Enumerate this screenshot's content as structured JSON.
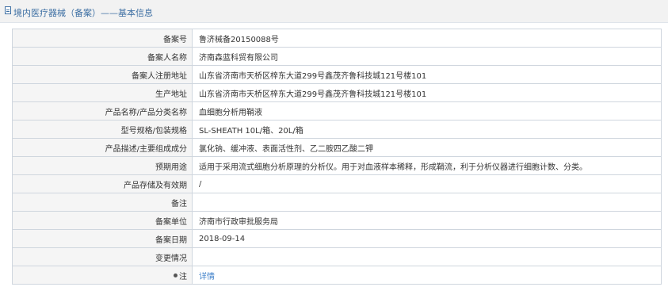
{
  "header": {
    "title": "境内医疗器械（备案）——基本信息",
    "icon": "document-icon"
  },
  "rows": [
    {
      "label": "备案号",
      "value": "鲁济械备20150088号"
    },
    {
      "label": "备案人名称",
      "value": "济南森蓝科贸有限公司"
    },
    {
      "label": "备案人注册地址",
      "value": "山东省济南市天桥区梓东大道299号鑫茂齐鲁科技城121号楼101"
    },
    {
      "label": "生产地址",
      "value": "山东省济南市天桥区梓东大道299号鑫茂齐鲁科技城121号楼101"
    },
    {
      "label": "产品名称/产品分类名称",
      "value": "血细胞分析用鞘液"
    },
    {
      "label": "型号规格/包装规格",
      "value": "SL-SHEATH 10L/箱、20L/箱"
    },
    {
      "label": "产品描述/主要组成成分",
      "value": "氯化钠、缓冲液、表面活性剂、乙二胺四乙酸二钾"
    },
    {
      "label": "预期用途",
      "value": "适用于采用流式细胞分析原理的分析仪。用于对血液样本稀释，形成鞘流，利于分析仪器进行细胞计数、分类。"
    },
    {
      "label": "产品存储及有效期",
      "value": "/"
    },
    {
      "label": "备注",
      "value": ""
    },
    {
      "label": "备案单位",
      "value": "济南市行政审批服务局"
    },
    {
      "label": "备案日期",
      "value": "2018-09-14"
    },
    {
      "label": "变更情况",
      "value": ""
    }
  ],
  "note": {
    "label": "注",
    "icon": "pin-icon",
    "link": "详情"
  },
  "colors": {
    "link": "#3d7fc9",
    "title": "#3d6fa3",
    "label_bg": "#f5f5f5",
    "border": "#cfd6de"
  }
}
